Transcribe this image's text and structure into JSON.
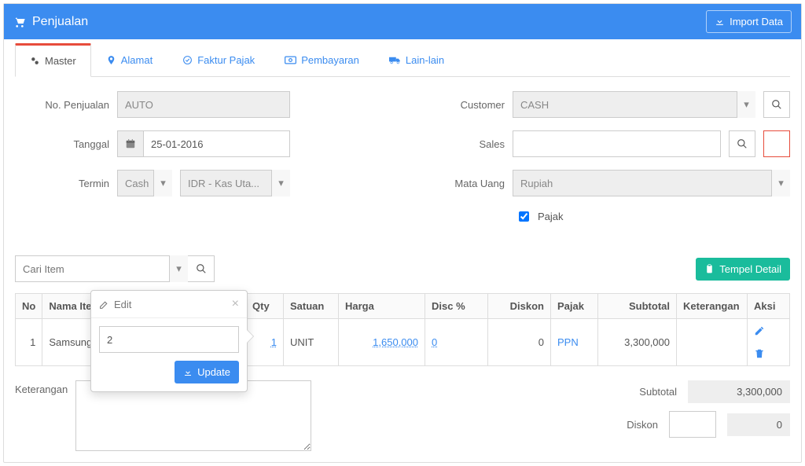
{
  "header": {
    "title": "Penjualan",
    "import_button": "Import Data"
  },
  "tabs": [
    {
      "label": "Master",
      "icon": "gears"
    },
    {
      "label": "Alamat",
      "icon": "pin"
    },
    {
      "label": "Faktur Pajak",
      "icon": "check-circle"
    },
    {
      "label": "Pembayaran",
      "icon": "money"
    },
    {
      "label": "Lain-lain",
      "icon": "truck"
    }
  ],
  "form": {
    "labels": {
      "no_penjualan": "No. Penjualan",
      "tanggal": "Tanggal",
      "termin": "Termin",
      "customer": "Customer",
      "sales": "Sales",
      "mata_uang": "Mata Uang",
      "pajak": "Pajak"
    },
    "values": {
      "no_penjualan": "AUTO",
      "tanggal": "25-01-2016",
      "termin_type": "Cash",
      "termin_account": "IDR - Kas Uta...",
      "customer": "CASH",
      "sales": "",
      "mata_uang": "Rupiah",
      "pajak_checked": true
    }
  },
  "item_bar": {
    "search_placeholder": "Cari Item",
    "tempel_button": "Tempel Detail"
  },
  "grid": {
    "headers": {
      "no": "No",
      "nama_item": "Nama Item",
      "qty": "Qty",
      "satuan": "Satuan",
      "harga": "Harga",
      "disc_pct": "Disc %",
      "diskon": "Diskon",
      "pajak": "Pajak",
      "subtotal": "Subtotal",
      "keterangan": "Keterangan",
      "aksi": "Aksi"
    },
    "rows": [
      {
        "no": "1",
        "nama_item": "Samsung",
        "qty": "1",
        "satuan": "UNIT",
        "harga": "1,650,000",
        "disc_pct": "0",
        "diskon": "0",
        "pajak": "PPN",
        "subtotal": "3,300,000",
        "keterangan": ""
      }
    ]
  },
  "footer": {
    "keterangan_label": "Keterangan",
    "totals": {
      "subtotal_label": "Subtotal",
      "subtotal_value": "3,300,000",
      "diskon_label": "Diskon",
      "diskon_input": "",
      "diskon_value": "0"
    }
  },
  "popover": {
    "title": "Edit",
    "input_value": "2",
    "update_button": "Update"
  }
}
